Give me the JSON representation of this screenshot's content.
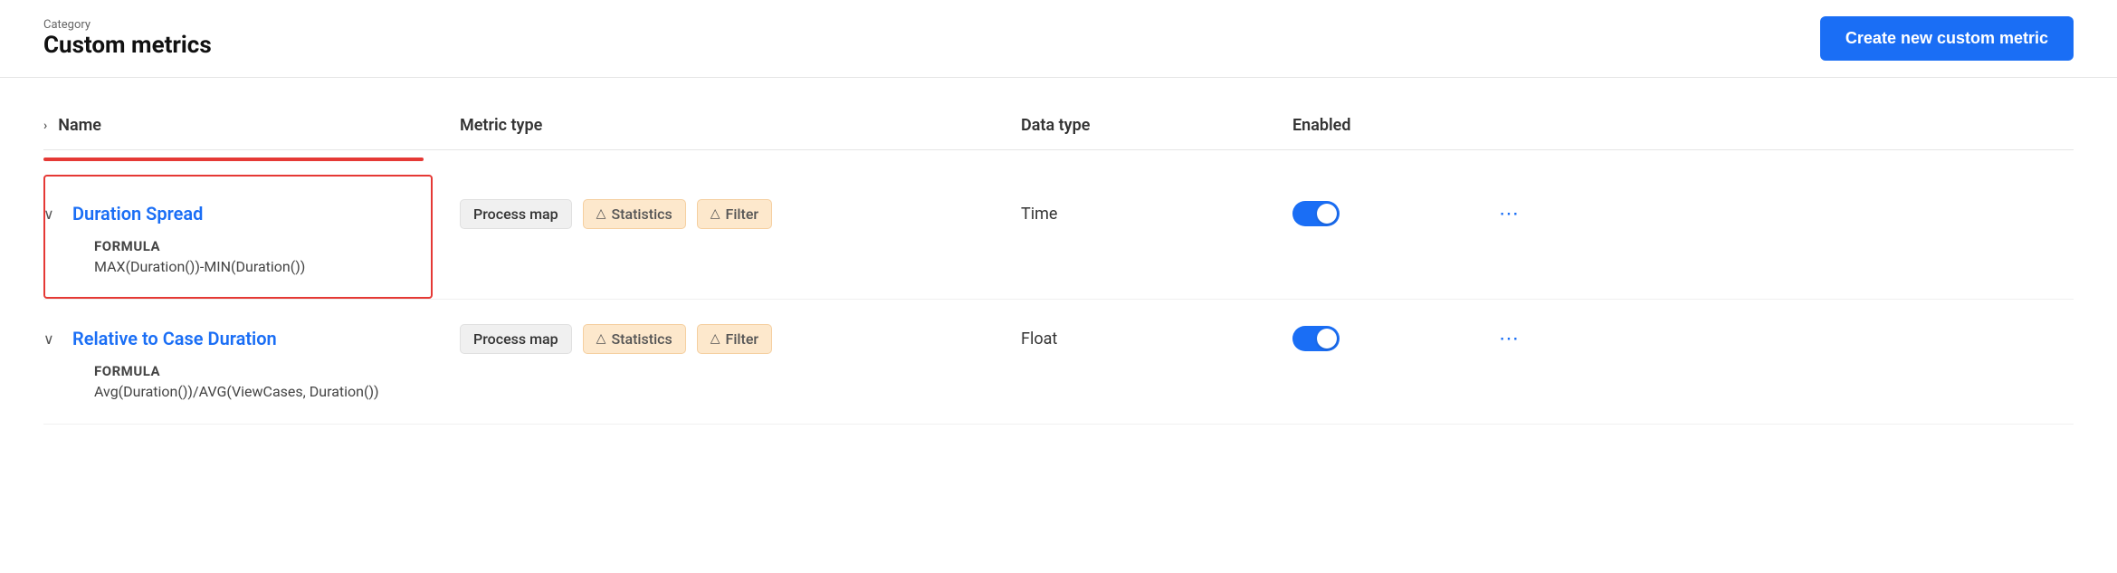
{
  "header": {
    "category_label": "Category",
    "page_title": "Custom metrics",
    "create_button_label": "Create new custom metric"
  },
  "table": {
    "columns": {
      "name": "Name",
      "metric_type": "Metric type",
      "data_type": "Data type",
      "enabled": "Enabled"
    },
    "rows": [
      {
        "id": "duration-spread",
        "name": "Duration Spread",
        "expanded": true,
        "highlighted": true,
        "metric_types": [
          {
            "label": "Process map",
            "variant": "gray"
          },
          {
            "label": "Statistics",
            "variant": "orange",
            "warn": true
          },
          {
            "label": "Filter",
            "variant": "orange",
            "warn": true
          }
        ],
        "data_type": "Time",
        "enabled": true,
        "formula_label": "FORMULA",
        "formula_value": "MAX(Duration())-MIN(Duration())"
      },
      {
        "id": "relative-to-case-duration",
        "name": "Relative to Case Duration",
        "expanded": true,
        "highlighted": false,
        "metric_types": [
          {
            "label": "Process map",
            "variant": "gray"
          },
          {
            "label": "Statistics",
            "variant": "orange",
            "warn": true
          },
          {
            "label": "Filter",
            "variant": "orange",
            "warn": true
          }
        ],
        "data_type": "Float",
        "enabled": true,
        "formula_label": "FORMULA",
        "formula_value": "Avg(Duration())/AVG(ViewCases, Duration())"
      }
    ]
  }
}
